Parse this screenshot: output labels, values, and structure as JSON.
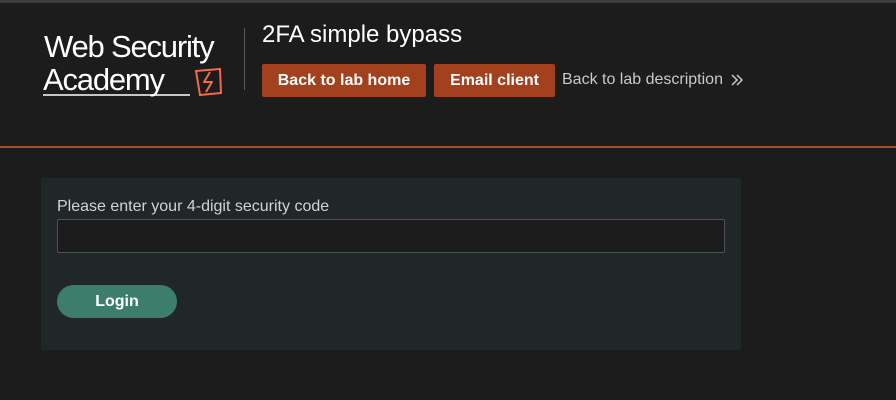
{
  "header": {
    "logo": {
      "line1": "Web Security",
      "line2": "Academy",
      "accent_color": "#f26a4b"
    },
    "lab_title": "2FA simple bypass",
    "buttons": {
      "back_to_lab_home": "Back to lab home",
      "email_client": "Email client"
    },
    "description_link": "Back to lab description",
    "description_link_icon": "double-chevron-right-icon"
  },
  "form": {
    "code_label": "Please enter your 4-digit security code",
    "code_value": "",
    "login_label": "Login"
  },
  "colors": {
    "page_background": "#1c1c1d",
    "header_rule": "#a0502c",
    "orange_button": "#a3401d",
    "panel_background": "#212729",
    "login_button": "#3d7d6b"
  }
}
